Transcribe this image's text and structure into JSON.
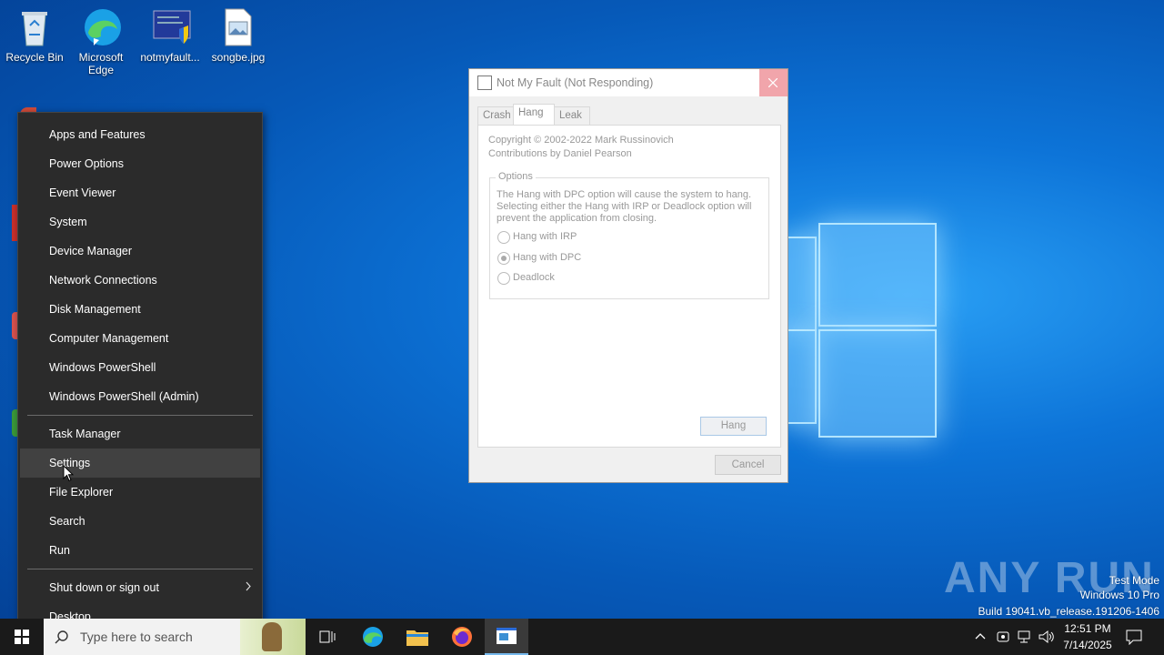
{
  "desktop": {
    "icons": [
      {
        "label": "Recycle Bin"
      },
      {
        "label": "Microsoft Edge"
      },
      {
        "label": "notmyfault..."
      },
      {
        "label": "songbe.jpg"
      }
    ]
  },
  "winx_menu": {
    "items": [
      {
        "label": "Apps and Features"
      },
      {
        "label": "Power Options"
      },
      {
        "label": "Event Viewer"
      },
      {
        "label": "System"
      },
      {
        "label": "Device Manager"
      },
      {
        "label": "Network Connections"
      },
      {
        "label": "Disk Management"
      },
      {
        "label": "Computer Management"
      },
      {
        "label": "Windows PowerShell"
      },
      {
        "label": "Windows PowerShell (Admin)"
      },
      {
        "label": "Task Manager"
      },
      {
        "label": "Settings"
      },
      {
        "label": "File Explorer"
      },
      {
        "label": "Search"
      },
      {
        "label": "Run"
      },
      {
        "label": "Shut down or sign out"
      },
      {
        "label": "Desktop"
      }
    ],
    "highlighted": "Settings"
  },
  "window": {
    "title": "Not My Fault (Not Responding)",
    "tabs": [
      {
        "label": "Crash"
      },
      {
        "label": "Hang"
      },
      {
        "label": "Leak"
      }
    ],
    "active_tab": "Hang",
    "copyright": "Copyright © 2002-2022 Mark Russinovich",
    "contributions": "Contributions by Daniel Pearson",
    "options_label": "Options",
    "description": "The Hang with DPC option will cause the system to hang. Selecting either the Hang with IRP or Deadlock option will prevent the application from closing.",
    "radios": [
      {
        "label": "Hang with IRP",
        "checked": false
      },
      {
        "label": "Hang with DPC",
        "checked": true
      },
      {
        "label": "Deadlock",
        "checked": false
      }
    ],
    "hang_button": "Hang",
    "cancel_button": "Cancel"
  },
  "taskbar": {
    "search_placeholder": "Type here to search",
    "time": "12:51 PM",
    "date": "7/14/2025"
  },
  "watermark": {
    "line1": "Test Mode",
    "line2": "Windows 10 Pro",
    "line3": "Build 19041.vb_release.191206-1406",
    "brand": "ANY RUN"
  },
  "colors": {
    "menu_bg": "#2b2b2b",
    "menu_hover": "#414141",
    "close_button": "#f1a5ab",
    "taskbar": "#1a1a1a"
  }
}
